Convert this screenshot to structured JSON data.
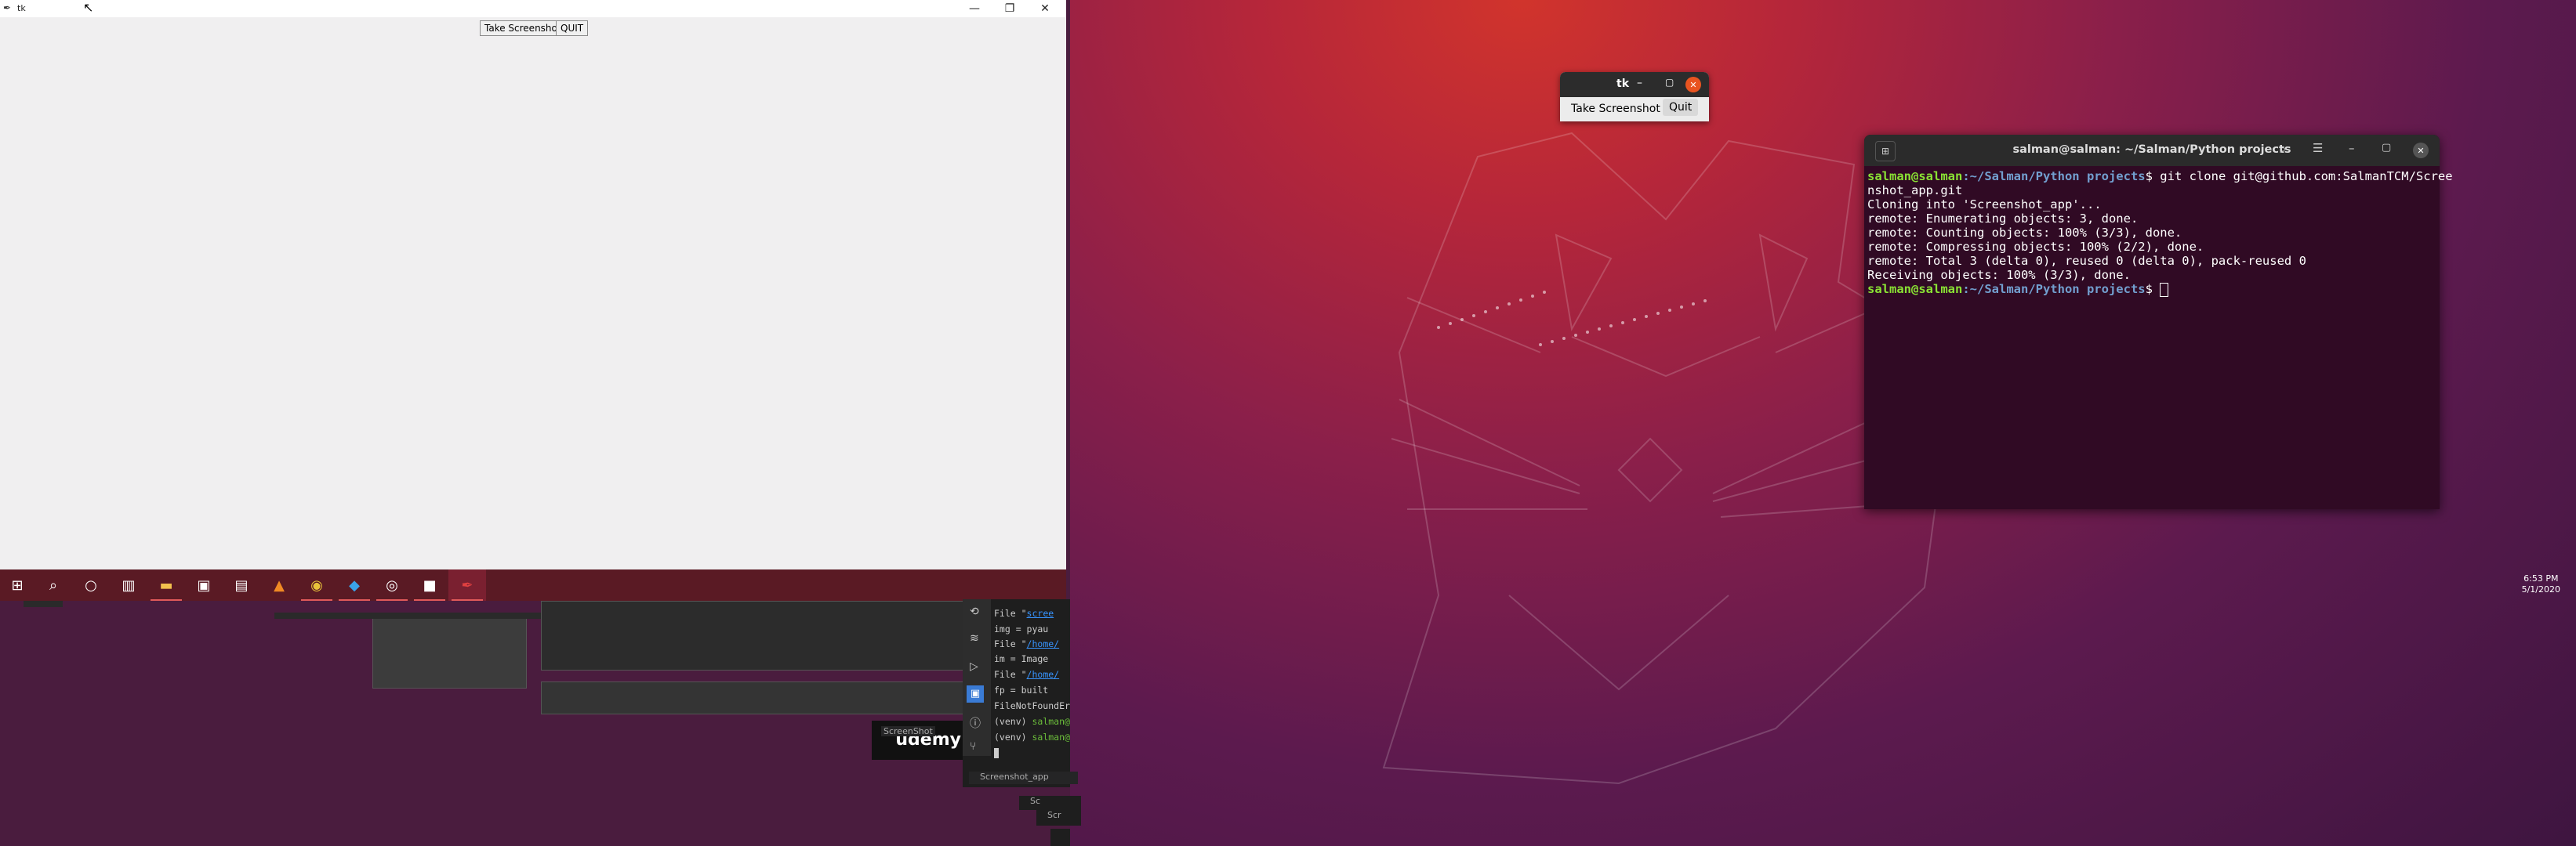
{
  "windows_side": {
    "tk_window": {
      "title": "tk",
      "minimize": "—",
      "maximize": "❐",
      "close": "✕",
      "take_screenshot_label": "Take Screenshot",
      "quit_label": "QUIT"
    },
    "taskbar": {
      "icons": [
        "windows-start-icon",
        "search-icon",
        "cortana-icon",
        "task-view-icon",
        "file-explorer-icon",
        "store-icon",
        "terminal-icon",
        "vlc-icon",
        "chrome-icon",
        "vscode-icon",
        "app-icon",
        "cmd-icon",
        "feather-icon"
      ],
      "time": "6:53 PM",
      "date": "5/1/2020"
    },
    "vscode_fragment": {
      "lines": [
        {
          "prefix": "File \"",
          "link": "scree",
          "suffix": ""
        },
        {
          "prefix": "  img = pyau",
          "link": "",
          "suffix": ""
        },
        {
          "prefix": "File \"",
          "link": "/home/",
          "suffix": ""
        },
        {
          "prefix": "  im = Image",
          "link": "",
          "suffix": ""
        },
        {
          "prefix": "File \"",
          "link": "/home/",
          "suffix": ""
        },
        {
          "prefix": "  fp = built",
          "link": "",
          "suffix": ""
        },
        {
          "prefix": "FileNotFoundEr",
          "link": "",
          "suffix": ""
        },
        {
          "prefix": "(venv) ",
          "green": "salman@",
          "suffix": ""
        },
        {
          "prefix": "(venv) ",
          "green": "salman@",
          "suffix": ""
        }
      ],
      "breadcrumb_1": "ScreenShot",
      "breadcrumb_2": "Screenshot_app",
      "badge_text": "udemy",
      "frag_1": "Sc",
      "frag_2": "Scr"
    }
  },
  "ubuntu_side": {
    "tk_window": {
      "title": "tk",
      "take_screenshot_label": "Take Screenshot",
      "quit_label": "Quit"
    },
    "terminal": {
      "title": "salman@salman: ~/Salman/Python projects",
      "prompt_user": "salman@salman",
      "prompt_path": ":~/Salman/Python projects",
      "command": "$ git clone git@github.com:SalmanTCM/Scree",
      "command_wrap": "nshot_app.git",
      "output": [
        "Cloning into 'Screenshot_app'...",
        "remote: Enumerating objects: 3, done.",
        "remote: Counting objects: 100% (3/3), done.",
        "remote: Compressing objects: 100% (2/2), done.",
        "remote: Total 3 (delta 0), reused 0 (delta 0), pack-reused 0",
        "Receiving objects: 100% (3/3), done."
      ],
      "prompt_end": "$ "
    }
  },
  "colors": {
    "ubuntu_orange": "#e95420",
    "terminal_bg": "#300a24",
    "taskbar": "#5a1a24"
  }
}
